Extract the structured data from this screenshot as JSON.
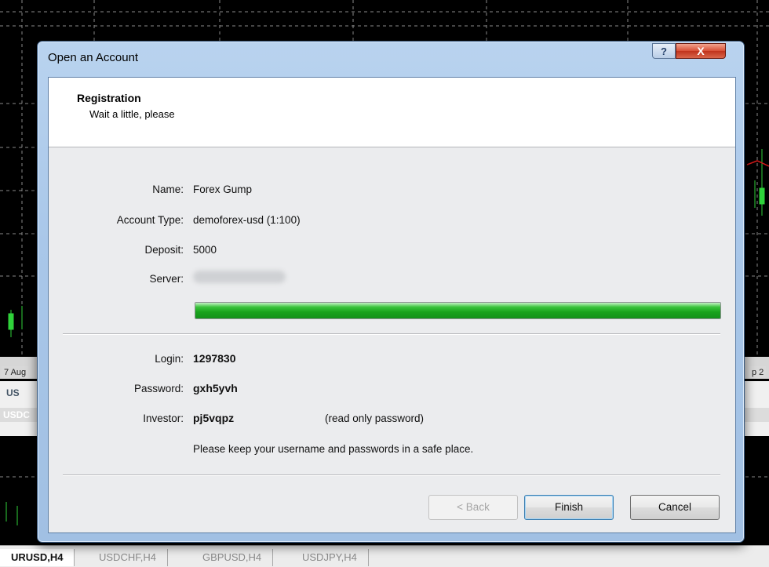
{
  "background": {
    "date_left": "7 Aug",
    "date_right": "p 2",
    "side_labels": [
      "US",
      "USDC"
    ],
    "tabs": [
      {
        "label": "URUSD,H4",
        "active": true
      },
      {
        "label": "USDCHF,H4",
        "active": false
      },
      {
        "label": "GBPUSD,H4",
        "active": false
      },
      {
        "label": "USDJPY,H4",
        "active": false
      }
    ]
  },
  "dialog": {
    "title": "Open an Account",
    "help_label": "?",
    "close_label": "X",
    "header": {
      "title": "Registration",
      "subtitle": "Wait a little, please"
    },
    "fields": {
      "name_label": "Name:",
      "name_value": "Forex Gump",
      "account_type_label": "Account Type:",
      "account_type_value": "demoforex-usd (1:100)",
      "deposit_label": "Deposit:",
      "deposit_value": "5000",
      "server_label": "Server:"
    },
    "progress": {
      "value": 1.0,
      "color": "#1aa51d"
    },
    "credentials": {
      "login_label": "Login:",
      "login_value": "1297830",
      "password_label": "Password:",
      "password_value": "gxh5yvh",
      "investor_label": "Investor:",
      "investor_value": "pj5vqpz",
      "investor_note": "(read only password)",
      "safe_note": "Please keep your username and passwords in a safe place."
    },
    "buttons": {
      "back": "< Back",
      "finish": "Finish",
      "cancel": "Cancel"
    }
  }
}
